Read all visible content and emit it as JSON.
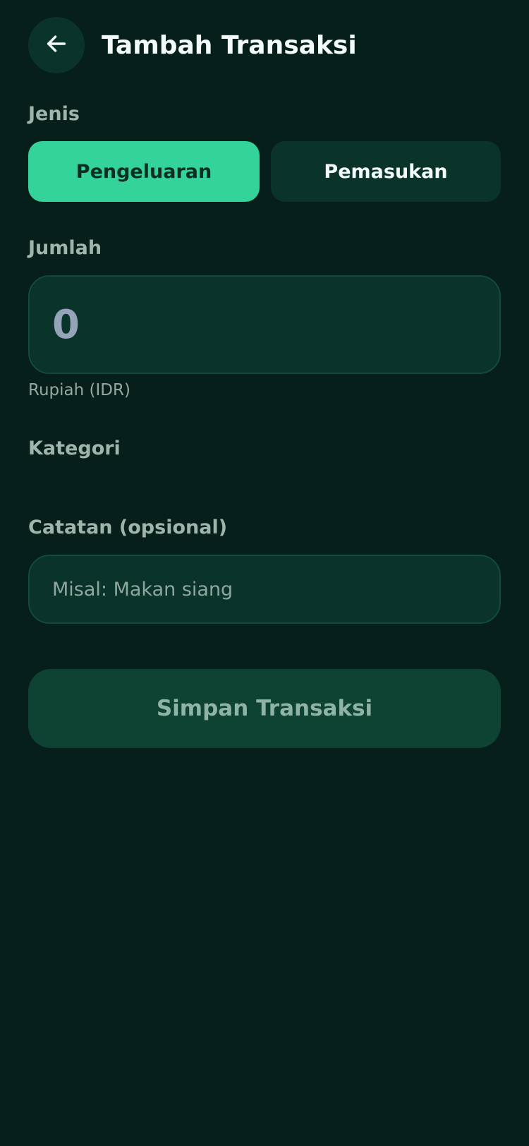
{
  "header": {
    "back_icon": "arrow-left-icon",
    "title": "Tambah Transaksi"
  },
  "type_section": {
    "label": "Jenis",
    "options": [
      {
        "label": "Pengeluaran",
        "selected": true
      },
      {
        "label": "Pemasukan",
        "selected": false
      }
    ]
  },
  "amount_section": {
    "label": "Jumlah",
    "value": "0",
    "currency_hint": "Rupiah (IDR)"
  },
  "category_section": {
    "label": "Kategori"
  },
  "note_section": {
    "label": "Catatan (opsional)",
    "value": "",
    "placeholder": "Misal: Makan siang"
  },
  "save_button": {
    "label": "Simpan Transaksi"
  },
  "colors": {
    "background": "#061f1a",
    "surface": "#0a3329",
    "accent": "#34d399",
    "text_primary": "#f2fbf7",
    "text_muted": "#9db5ab"
  }
}
